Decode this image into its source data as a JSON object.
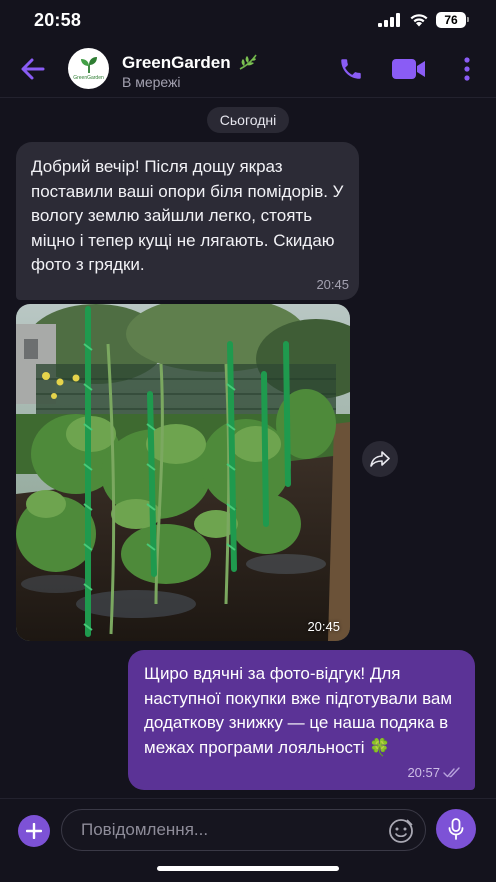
{
  "status_bar": {
    "time": "20:58",
    "battery": "76"
  },
  "header": {
    "contact_name": "GreenGarden",
    "contact_status": "В мережі",
    "avatar_text": "GreenGarden",
    "accent_color": "#8a5cf5"
  },
  "chat": {
    "date_label": "Сьогодні",
    "incoming": {
      "text": "Добрий вечір! Після дощу якраз поставили ваші опори біля помідорів. У вологу землю зайшли легко, стоять міцно і тепер кущі не лягають. Скидаю фото з грядки.",
      "time": "20:45"
    },
    "photo": {
      "time": "20:45",
      "subject": "tomato plants supported by green spiral stakes in wet garden bed"
    },
    "outgoing": {
      "text": "Щиро вдячні за фото-відгук! Для наступної покупки вже підготували вам додаткову знижку — це наша подяка в межах програми лояльності 🍀",
      "time": "20:57"
    }
  },
  "composer": {
    "placeholder": "Повідомлення..."
  },
  "icons": [
    "back-arrow-icon",
    "leaf-icon",
    "phone-icon",
    "video-camera-icon",
    "more-vertical-icon",
    "share-arrow-icon",
    "plus-icon",
    "sticker-icon",
    "microphone-icon",
    "signal-icon",
    "wifi-icon",
    "read-checks-icon"
  ]
}
